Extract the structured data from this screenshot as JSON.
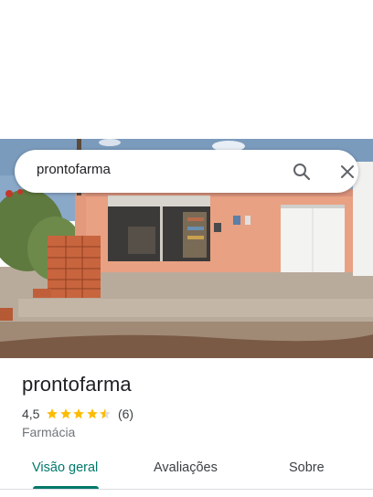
{
  "search": {
    "query": "prontofarma"
  },
  "place": {
    "name": "prontofarma",
    "rating_text": "4,5",
    "rating_value": 4.5,
    "review_count_text": "(6)",
    "category": "Farmácia"
  },
  "colors": {
    "accent": "#00796b",
    "star": "#fbbc04"
  },
  "icons": {
    "search": "search-icon",
    "close": "close-icon",
    "star": "star-icon"
  },
  "tabs": [
    {
      "label": "Visão geral",
      "active": true
    },
    {
      "label": "Avaliações",
      "active": false
    },
    {
      "label": "Sobre",
      "active": false
    }
  ]
}
